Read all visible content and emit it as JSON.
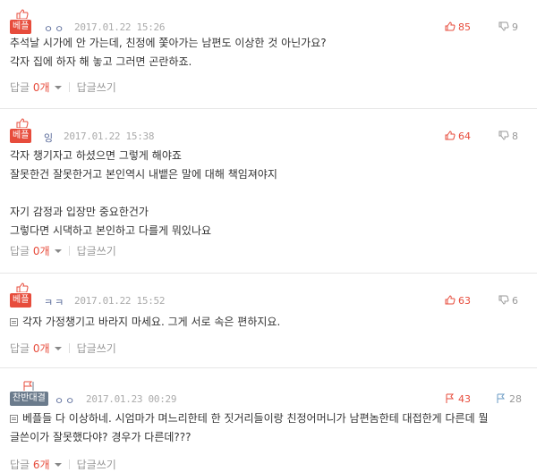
{
  "comments": [
    {
      "badge": "베플",
      "badge_type": "best",
      "nickname": "ㅇㅇ",
      "date": "2017.01.22 15:26",
      "up": "85",
      "down": "9",
      "body": "추석날 시가에 안 가는데, 친정에 쫓아가는 남편도 이상한 것 아닌가요?\n각자 집에 하자 해 놓고 그러면 곤란하죠.",
      "reply_label": "답글",
      "reply_count": "0개",
      "write_reply": "답글쓰기"
    },
    {
      "badge": "베플",
      "badge_type": "best",
      "nickname": "잉",
      "date": "2017.01.22 15:38",
      "up": "64",
      "down": "8",
      "body": "각자 챙기자고 하셨으면 그렇게 해야죠\n잘못한건 잘못한거고 본인역시 내뱉은 말에 대해 책임져야지\n\n자기 감정과 입장만 중요한건가\n그렇다면 시댁하고 본인하고 다를게 뭐있나요",
      "reply_label": "답글",
      "reply_count": "0개",
      "write_reply": "답글쓰기"
    },
    {
      "badge": "베플",
      "badge_type": "best",
      "nickname": "ㅋㅋ",
      "date": "2017.01.22 15:52",
      "up": "63",
      "down": "6",
      "body": "각자 가정챙기고 바라지 마세요. 그게 서로 속은 편하지요.",
      "reply_label": "답글",
      "reply_count": "0개",
      "write_reply": "답글쓰기"
    },
    {
      "badge": "찬반대결",
      "badge_type": "worst",
      "nickname": "ㅇㅇ",
      "date": "2017.01.23 00:29",
      "up": "43",
      "down": "28",
      "body": "베플들 다 이상하네. 시엄마가 며느리한테 한 짓거리들이랑 친정어머니가 남편놈한테 대접한게 다른데 뭘\n글쓴이가 잘못했다야? 경우가 다른데???",
      "reply_label": "답글",
      "reply_count": "6개",
      "write_reply": "답글쓰기"
    }
  ],
  "colors": {
    "accent_red": "#e74c3c",
    "muted": "#999999",
    "nickname": "#5a6b9a"
  },
  "icons": {
    "up": "thumbs-up-icon",
    "down": "thumbs-down-icon",
    "badge": "thumbs-up-badge-icon"
  }
}
